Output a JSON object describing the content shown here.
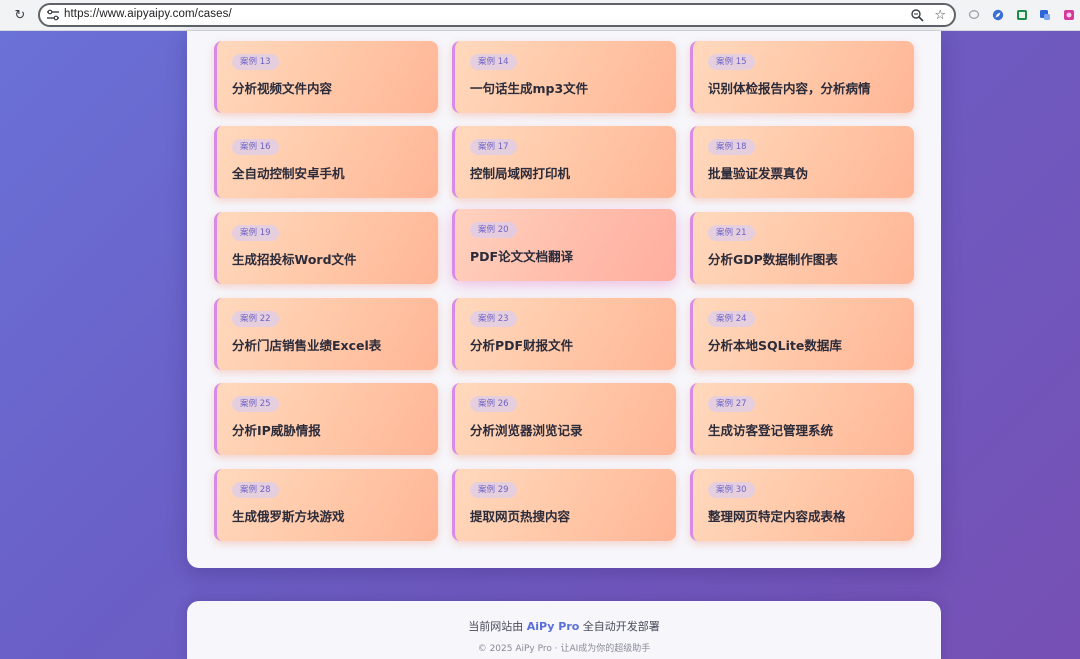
{
  "browser": {
    "url": "https://www.aipyaipy.com/cases/",
    "reload_glyph": "↻",
    "star_glyph": "☆",
    "extension_colors": [
      "#9aa0a6",
      "#3b6fd6",
      "#1f8a4c",
      "#2f63d8",
      "#d5389a"
    ]
  },
  "cases": [
    {
      "badge": "案例 13",
      "title": "分析视频文件内容"
    },
    {
      "badge": "案例 14",
      "title": "一句话生成mp3文件"
    },
    {
      "badge": "案例 15",
      "title": "识别体检报告内容，分析病情"
    },
    {
      "badge": "案例 16",
      "title": "全自动控制安卓手机"
    },
    {
      "badge": "案例 17",
      "title": "控制局域网打印机"
    },
    {
      "badge": "案例 18",
      "title": "批量验证发票真伪"
    },
    {
      "badge": "案例 19",
      "title": "生成招投标Word文件"
    },
    {
      "badge": "案例 20",
      "title": "PDF论文文档翻译"
    },
    {
      "badge": "案例 21",
      "title": "分析GDP数据制作图表"
    },
    {
      "badge": "案例 22",
      "title": "分析门店销售业绩Excel表"
    },
    {
      "badge": "案例 23",
      "title": "分析PDF财报文件"
    },
    {
      "badge": "案例 24",
      "title": "分析本地SQLite数据库"
    },
    {
      "badge": "案例 25",
      "title": "分析IP威胁情报"
    },
    {
      "badge": "案例 26",
      "title": "分析浏览器浏览记录"
    },
    {
      "badge": "案例 27",
      "title": "生成访客登记管理系统"
    },
    {
      "badge": "案例 28",
      "title": "生成俄罗斯方块游戏"
    },
    {
      "badge": "案例 29",
      "title": "提取网页热搜内容"
    },
    {
      "badge": "案例 30",
      "title": "整理网页特定内容成表格"
    }
  ],
  "footer": {
    "prefix": "当前网站由",
    "brand": "AiPy Pro",
    "suffix": "全自动开发部署",
    "copyright": "© 2025 AiPy Pro · 让AI成为你的超级助手"
  },
  "colors": {
    "accent": "#5b6fd8",
    "card_border": "#d88be6",
    "badge_text": "#6b63c7"
  }
}
